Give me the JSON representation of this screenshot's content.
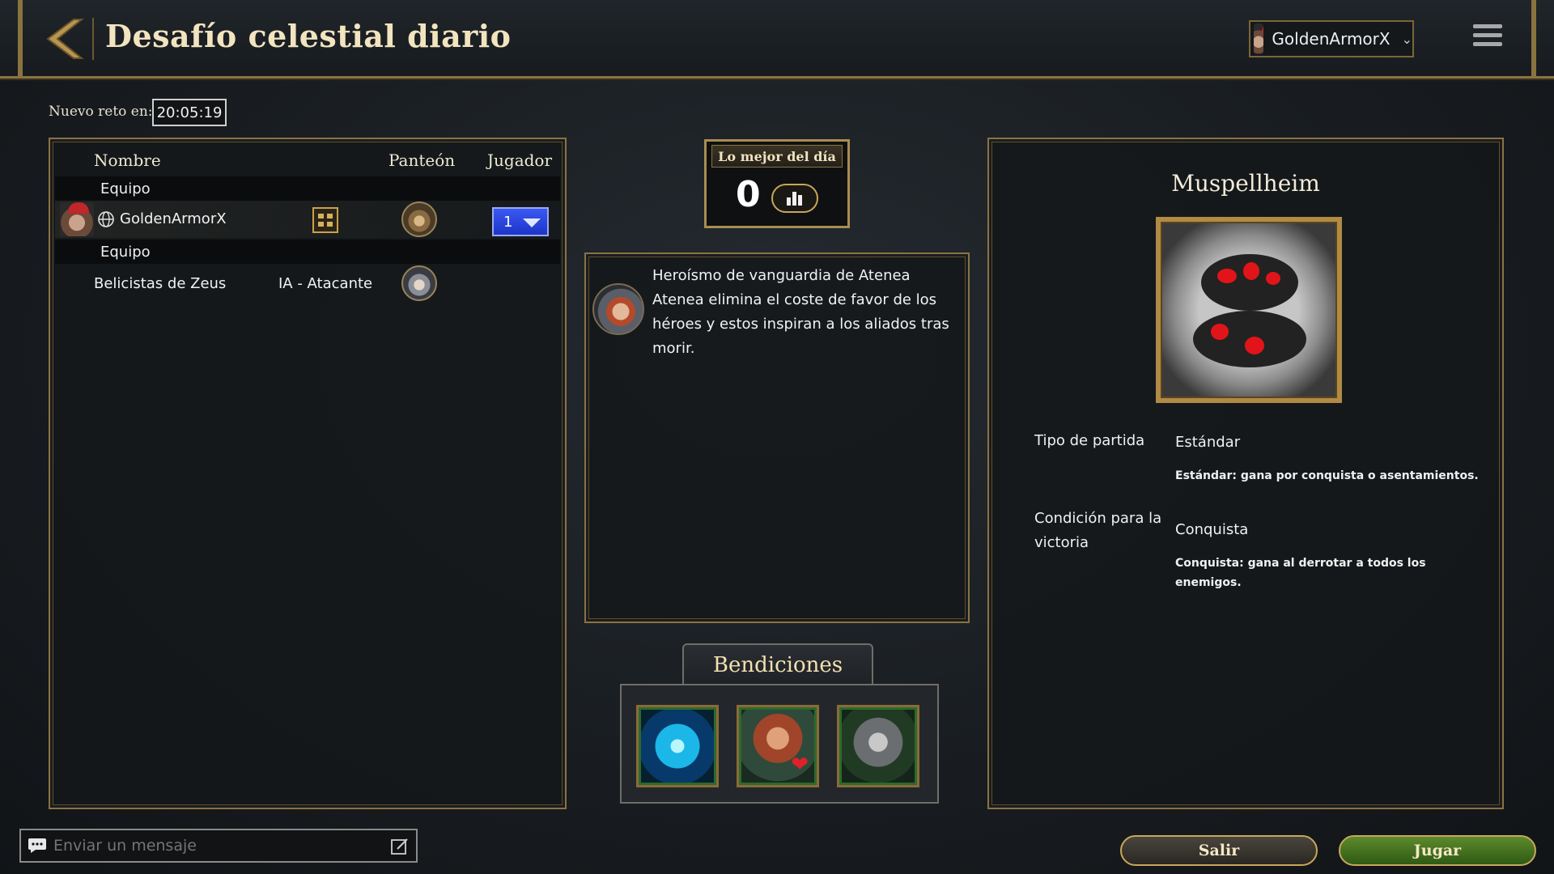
{
  "header": {
    "title": "Desafío celestial diario",
    "user": "GoldenArmorX"
  },
  "timer": {
    "label": "Nuevo reto en:",
    "value": "20:05:19"
  },
  "lobby": {
    "columns": {
      "name": "Nombre",
      "pantheon": "Panteón",
      "player": "Jugador"
    },
    "team1_label": "Equipo",
    "player_row": {
      "name": "GoldenArmorX",
      "player_slot": "1"
    },
    "team2_label": "Equipo",
    "ai_row": {
      "name": "Belicistas de Zeus",
      "type": "IA - Atacante"
    }
  },
  "best_of_day": {
    "title": "Lo mejor del día",
    "score": "0"
  },
  "modifier": {
    "title": "Heroísmo de vanguardia de Atenea",
    "text": "Atenea elimina el coste de favor de los héroes y estos inspiran a los aliados tras morir."
  },
  "blessings": {
    "title": "Bendiciones",
    "icons": [
      "blue-vortex-blessing-icon",
      "dwarf-heart-blessing-icon",
      "armored-warrior-blessing-icon"
    ]
  },
  "map": {
    "name": "Muspellheim",
    "game_type_label": "Tipo de partida",
    "game_type_value": "Estándar",
    "game_type_desc": "Estándar: gana por conquista o asentamientos.",
    "victory_label": "Condición para la victoria",
    "victory_value": "Conquista",
    "victory_desc": "Conquista: gana al derrotar a todos los enemigos."
  },
  "chat": {
    "placeholder": "Enviar un mensaje"
  },
  "buttons": {
    "exit": "Salir",
    "play": "Jugar"
  },
  "colors": {
    "gold_accent": "#8a7340",
    "player_blue": "#2a45e0",
    "play_green": "#4a7a22"
  }
}
